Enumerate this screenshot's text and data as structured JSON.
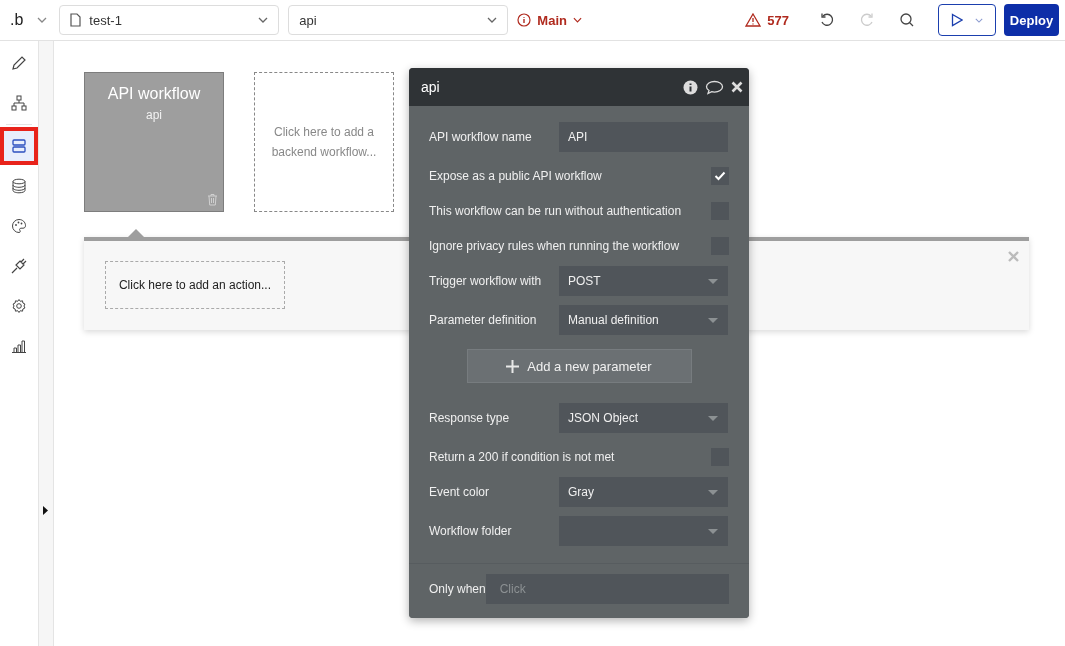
{
  "topbar": {
    "logo": ".b",
    "page_select": "test-1",
    "workflow_select": "api",
    "branch": "Main",
    "issue_count": "577",
    "deploy": "Deploy"
  },
  "sidebar": {
    "items": [
      {
        "selected": false
      },
      {
        "selected": false
      },
      {
        "selected": true
      },
      {
        "selected": false
      },
      {
        "selected": false
      },
      {
        "selected": false
      },
      {
        "selected": false
      },
      {
        "selected": false
      }
    ]
  },
  "canvas": {
    "workflow_cards": [
      {
        "title": "API workflow",
        "subtitle": "api"
      }
    ],
    "add_workflow_hint": "Click here to add a backend workflow...",
    "action_panel": {
      "add_action_hint": "Click here to add an action..."
    }
  },
  "popup": {
    "title": "api",
    "rows": [
      {
        "kind": "text",
        "label": "API workflow name",
        "value": "API"
      },
      {
        "kind": "checkbox",
        "label": "Expose as a public API workflow",
        "checked": true
      },
      {
        "kind": "checkbox",
        "label": "This workflow can be run without authentication",
        "checked": false
      },
      {
        "kind": "checkbox",
        "label": "Ignore privacy rules when running the workflow",
        "checked": false
      },
      {
        "kind": "select",
        "label": "Trigger workflow with",
        "value": "POST"
      },
      {
        "kind": "select",
        "label": "Parameter definition",
        "value": "Manual definition"
      },
      {
        "kind": "button",
        "label": "Add a new parameter"
      },
      {
        "kind": "select",
        "label": "Response type",
        "value": "JSON Object"
      },
      {
        "kind": "checkbox",
        "label": "Return a 200 if condition is not met",
        "checked": false
      },
      {
        "kind": "select",
        "label": "Event color",
        "value": "Gray"
      },
      {
        "kind": "select",
        "label": "Workflow folder"
      }
    ],
    "only_when": {
      "label": "Only when",
      "placeholder": "Click"
    }
  }
}
